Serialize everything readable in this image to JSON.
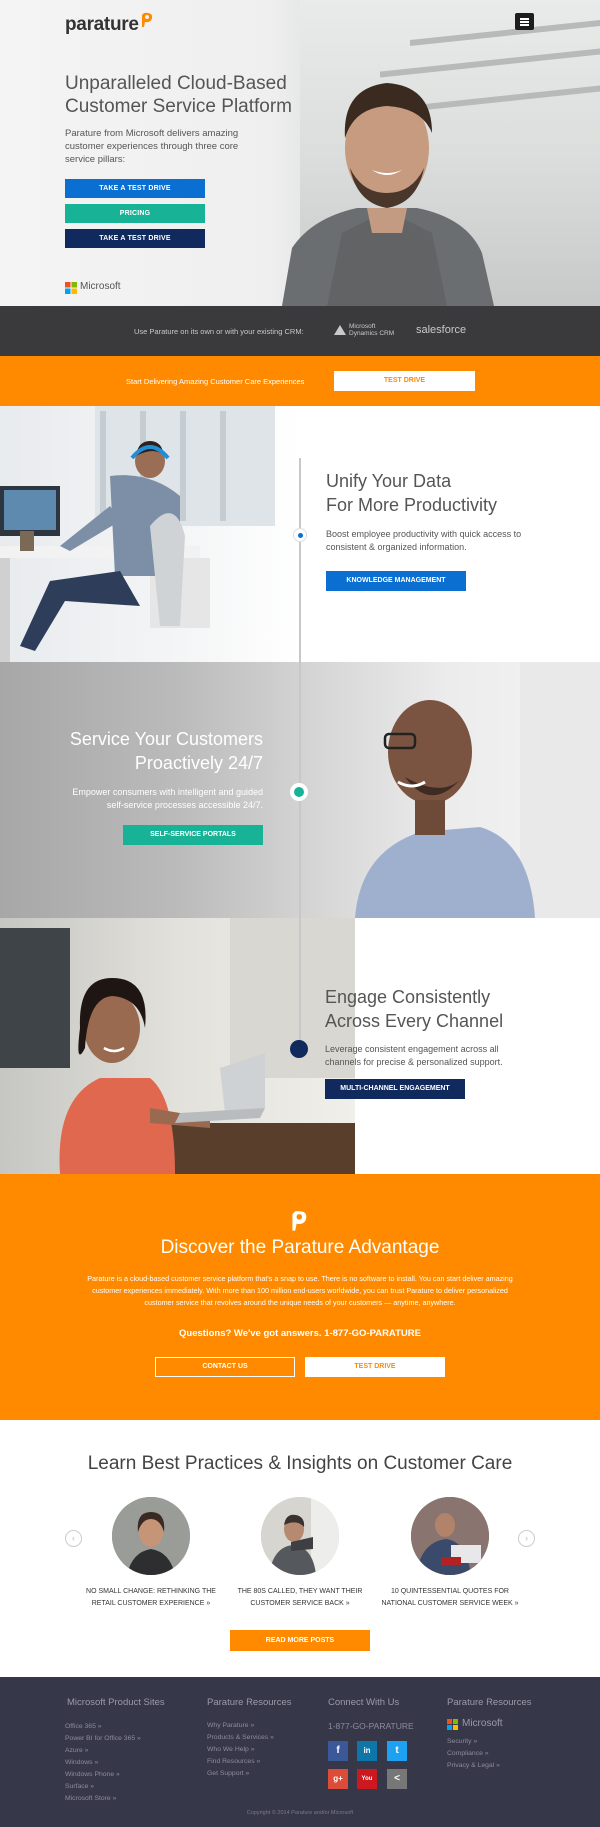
{
  "header": {
    "brand": "parature",
    "menu_icon": "menu-icon"
  },
  "hero": {
    "title": "Unparalleled Cloud-Based Customer Service Platform",
    "subtitle": "Parature from Microsoft delivers amazing customer experiences through three core service pillars:",
    "buttons": [
      {
        "label": "TAKE A TEST DRIVE",
        "color": "#0a6fd1"
      },
      {
        "label": "PRICING",
        "color": "#18b396"
      },
      {
        "label": "TAKE A TEST DRIVE",
        "color": "#102a5e"
      }
    ],
    "microsoft": "Microsoft"
  },
  "crm": {
    "text": "Use Parature on its own or with your existing CRM:",
    "dynamics": "Microsoft Dynamics CRM",
    "salesforce": "salesforce"
  },
  "promo": {
    "text": "Start Delivering Amazing Customer Care Experiences",
    "button": "TEST DRIVE"
  },
  "sections": [
    {
      "title_line1": "Unify Your Data",
      "title_line2": "For More Productivity",
      "desc": "Boost employee productivity with quick access to consistent & organized information.",
      "button": "KNOWLEDGE MANAGEMENT",
      "color": "#0a6fd1"
    },
    {
      "title_line1": "Service Your Customers",
      "title_line2": "Proactively 24/7",
      "desc": "Empower consumers with intelligent and guided self-service processes accessible 24/7.",
      "button": "SELF-SERVICE PORTALS",
      "color": "#18b396"
    },
    {
      "title_line1": "Engage Consistently",
      "title_line2": "Across Every Channel",
      "desc": "Leverage consistent engagement across all channels for precise & personalized support.",
      "button": "MULTI-CHANNEL ENGAGEMENT",
      "color": "#102a5e"
    }
  ],
  "discover": {
    "title": "Discover the Parature Advantage",
    "body": "Parature is a cloud-based customer service platform that's a snap to use. There is no software to install. You can start deliver amazing customer experiences immediately. With more than 100 million end-users worldwide, you can trust Parature to deliver personalized customer service that revolves around the unique needs of your customers — anytime, anywhere.",
    "question": "Questions? We've got answers. 1-877-GO-PARATURE",
    "contact_button": "CONTACT US",
    "test_button": "TEST DRIVE"
  },
  "learn": {
    "title": "Learn Best Practices & Insights on Customer Care",
    "posts": [
      {
        "line1": "NO SMALL CHANGE: RETHINKING THE",
        "line2": "RETAIL CUSTOMER EXPERIENCE »"
      },
      {
        "line1": "THE 80S CALLED, THEY WANT THEIR",
        "line2": "CUSTOMER SERVICE BACK »"
      },
      {
        "line1": "10 QUINTESSENTIAL QUOTES FOR",
        "line2": "NATIONAL CUSTOMER SERVICE WEEK »"
      }
    ],
    "read_more": "READ MORE POSTS"
  },
  "footer": {
    "col1": {
      "heading": "Microsoft Product Sites",
      "links": [
        "Office 365 »",
        "Power BI for Office 365 »",
        "Azure »",
        "Windows »",
        "Windows Phone »",
        "Surface »",
        "Microsoft Store »"
      ]
    },
    "col2": {
      "heading": "Parature Resources",
      "links": [
        "Why Parature »",
        "Products & Services »",
        "Who We Help »",
        "Find Resources »",
        "Get Support »"
      ]
    },
    "col3": {
      "heading": "Connect With Us",
      "phone": "1-877-GO-PARATURE",
      "social": [
        {
          "label": "f",
          "color": "#3b5998"
        },
        {
          "label": "in",
          "color": "#0e76a8"
        },
        {
          "label": "t",
          "color": "#1da1f2"
        },
        {
          "label": "g+",
          "color": "#dd4b39"
        },
        {
          "label": "You",
          "color": "#cc181e"
        },
        {
          "label": "<",
          "color": "#777777"
        }
      ]
    },
    "col4": {
      "heading": "Parature Resources",
      "brand": "Microsoft",
      "links": [
        "Security »",
        "Compliance »",
        "Privacy & Legal »"
      ]
    },
    "copyright": "Copyright © 2014 Parature and/or Microsoft"
  }
}
